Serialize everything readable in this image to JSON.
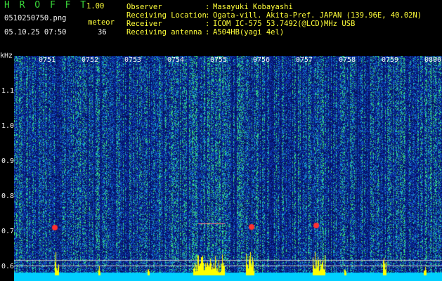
{
  "header": {
    "app_title": "H R O F F T",
    "app_version": "1.00",
    "file_name": "0510250750.png",
    "meteor_label": "meteor",
    "date_time": "05.10.25 07:50",
    "meteor_count": "36"
  },
  "info": [
    {
      "key": "Observer",
      "sep": ":",
      "value": "Masayuki Kobayashi"
    },
    {
      "key": "Receiving Location",
      "sep": ":",
      "value": "Ogata-vill. Akita-Pref. JAPAN (139.96E, 40.02N)"
    },
    {
      "key": "Receiver",
      "sep": ":",
      "value": "ICOM IC-575 53.7492(@LCD)MHz USB"
    },
    {
      "key": "Receiving antenna",
      "sep": ":",
      "value": "A504HB(yagi 4el)"
    }
  ],
  "axis": {
    "y_unit": "kHz",
    "y_ticks": [
      "1.1",
      "1.0",
      "0.9",
      "0.8",
      "0.7",
      "0.6"
    ],
    "x_ticks": [
      "0751",
      "0752",
      "0753",
      "0754",
      "0755",
      "0756",
      "0757",
      "0758",
      "0759",
      "0800"
    ]
  },
  "colors": {
    "background": "#000000",
    "label_green": "#39d639",
    "label_yellow": "#ffff3a",
    "label_white": "#f2f2f2",
    "spectrum_base": "#08186a",
    "noise_band": "#00d0ff",
    "meteor_peak": "#ffff00",
    "echo_marker": "#ff3030"
  }
}
